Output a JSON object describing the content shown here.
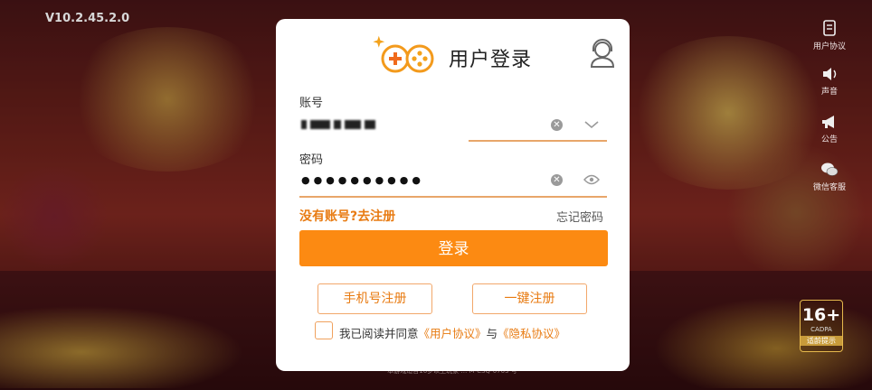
{
  "app": {
    "version": "V10.2.45.2.0"
  },
  "side_menu": [
    {
      "label": "用户协议",
      "icon": "document-icon"
    },
    {
      "label": "声音",
      "icon": "speaker-icon"
    },
    {
      "label": "公告",
      "icon": "megaphone-icon"
    },
    {
      "label": "微信客服",
      "icon": "wechat-icon"
    }
  ],
  "age_rating": {
    "value": "16+",
    "org": "CADPA",
    "label": "适龄提示"
  },
  "footer": {
    "notice": "健康游戏忠告：抵制不良游戏 … 合理安排时间 享受健康生活",
    "small": "本游戏适合16岁以上玩家 … M-CSQ-0703 号"
  },
  "dialog": {
    "title": "用户登录",
    "account_label": "账号",
    "password_label": "密码",
    "password_value": "●●●●●●●●●●",
    "register_link": "没有账号?去注册",
    "forgot_link": "忘记密码",
    "login_button": "登录",
    "phone_register_button": "手机号注册",
    "quick_register_button": "一键注册",
    "agree_prefix": "我已阅读并同意",
    "user_agreement": "《用户协议》",
    "and": "与",
    "privacy_policy": "《隐私协议》"
  },
  "colors": {
    "accent": "#fc8a12",
    "link": "#e87b12",
    "underline": "#e8a66a"
  }
}
